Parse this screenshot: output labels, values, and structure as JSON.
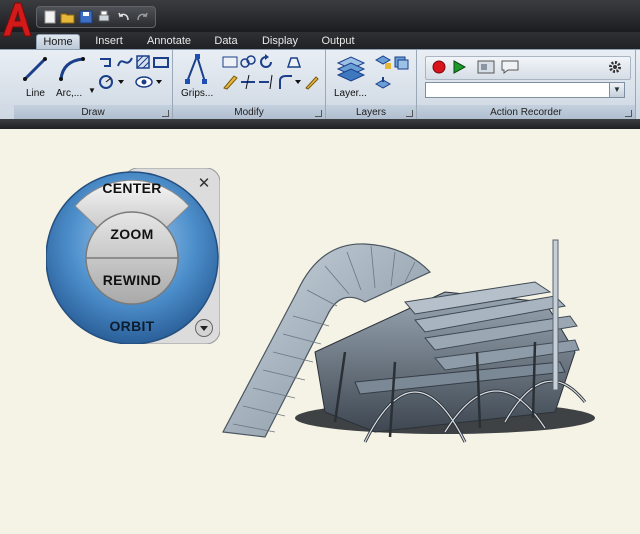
{
  "tabs": [
    {
      "label": "Home",
      "active": true
    },
    {
      "label": "Insert",
      "active": false
    },
    {
      "label": "Annotate",
      "active": false
    },
    {
      "label": "Data",
      "active": false
    },
    {
      "label": "Display",
      "active": false
    },
    {
      "label": "Output",
      "active": false
    }
  ],
  "quick_access": [
    "new-icon",
    "open-icon",
    "save-icon",
    "plot-icon",
    "undo-icon",
    "redo-icon"
  ],
  "panels": {
    "draw": {
      "title": "Draw",
      "line_label": "Line",
      "arc_label": "Arc,..."
    },
    "modify": {
      "title": "Modify",
      "grips_label": "Grips..."
    },
    "layers": {
      "title": "Layers",
      "layer_label": "Layer..."
    },
    "action_recorder": {
      "title": "Action Recorder",
      "combo_value": ""
    }
  },
  "wheel": {
    "center": "CENTER",
    "zoom": "ZOOM",
    "rewind": "REWIND",
    "orbit": "ORBIT",
    "close_glyph": "✕"
  },
  "colors": {
    "ribbon": "#cdd7e2",
    "viewport": "#f5f3e6",
    "wheel_ring": "#3a83c2",
    "record": "#d8141c",
    "play": "#1c9a2a"
  }
}
